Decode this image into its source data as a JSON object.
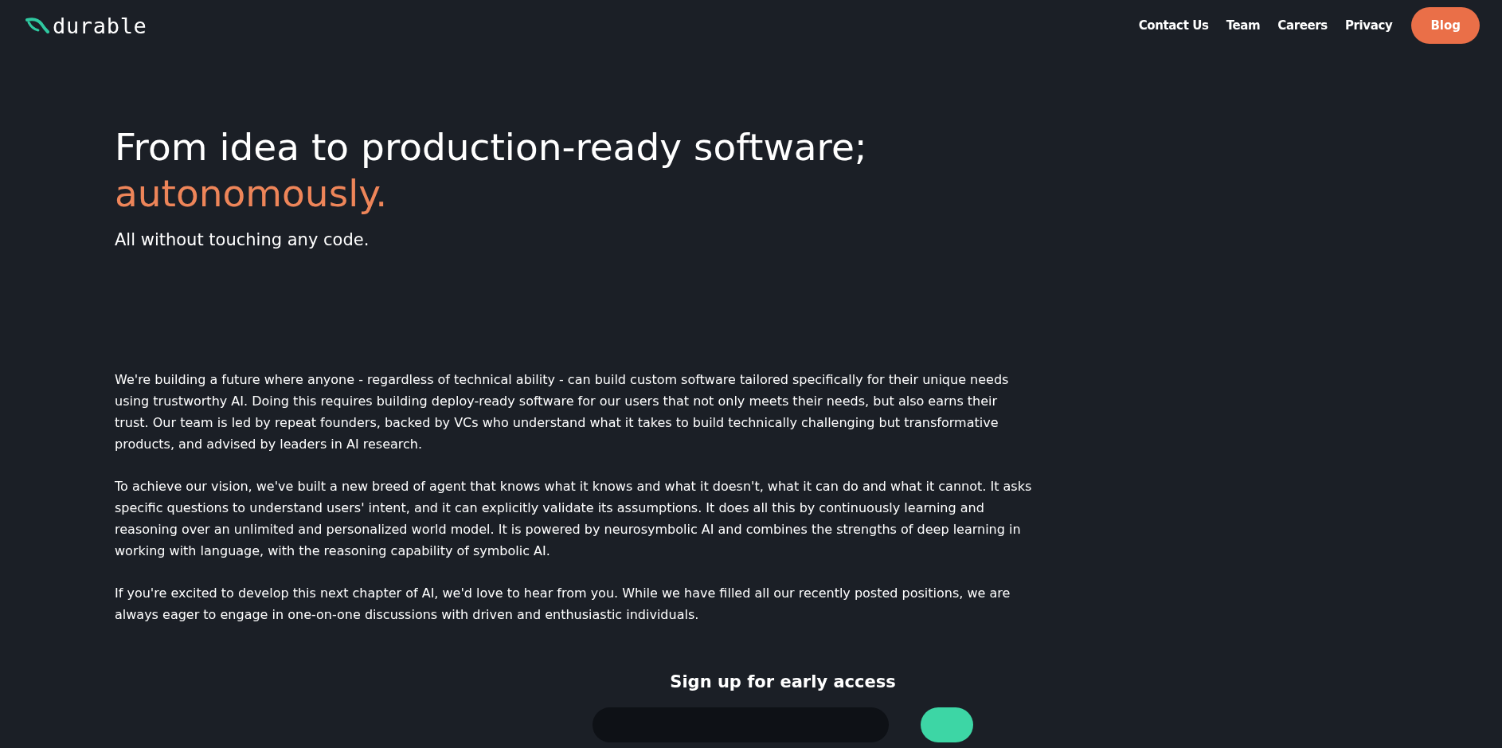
{
  "logo": {
    "text": "durable"
  },
  "nav": [
    {
      "label": "Contact Us",
      "kind": "link"
    },
    {
      "label": "Team",
      "kind": "link"
    },
    {
      "label": "Careers",
      "kind": "link"
    },
    {
      "label": "Privacy",
      "kind": "link"
    },
    {
      "label": "Blog",
      "kind": "button"
    }
  ],
  "hero": {
    "headline": "From idea to production-ready software;",
    "highlight": "autonomously.",
    "subtitle": "All without touching any code."
  },
  "paragraphs": [
    "We're building a future where anyone - regardless of technical ability - can build custom software tailored specifically for their unique needs using trustworthy AI. Doing this requires building deploy-ready software for our users that not only meets their needs, but also earns their trust. Our team is led by repeat founders, backed by VCs who understand what it takes to build technically challenging but transformative products, and advised by leaders in AI research.",
    "To achieve our vision, we've built a new breed of agent that knows what it knows and what it doesn't, what it can do and what it cannot. It asks specific questions to understand users' intent, and it can explicitly validate its assumptions. It does all this by continuously learning and reasoning over an unlimited and personalized world model. It is powered by neurosymbolic AI and combines the strengths of deep learning in working with language, with the reasoning capability of symbolic AI.",
    "If you're excited to develop this next chapter of AI, we'd love to hear from you. While we have filled all our recently posted positions, we are always eager to engage in one-on-one discussions with driven and enthusiastic individuals."
  ],
  "signup": {
    "title": "Sign up for early access"
  }
}
